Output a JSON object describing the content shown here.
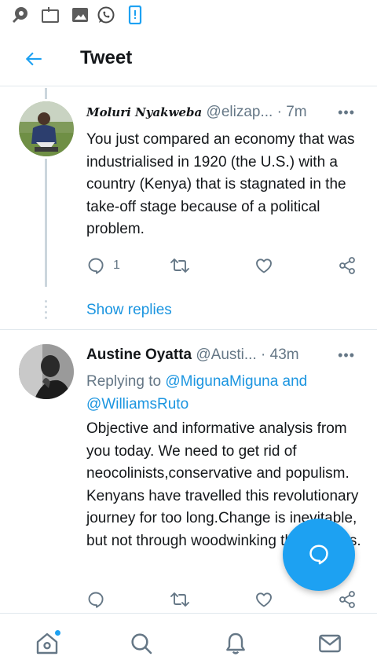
{
  "status_bar": {
    "icons": [
      "sync-icon",
      "notification-card-icon",
      "image-icon",
      "whatsapp-icon",
      "phone-icon"
    ]
  },
  "header": {
    "title": "Tweet",
    "back_icon": "arrow-left-icon"
  },
  "tweets": [
    {
      "display_name": "𝑴𝒐𝒍𝒖𝒓𝒊 𝑵𝒚𝒂𝒌𝒘𝒆𝒃𝒂",
      "handle": "@elizap...",
      "time": "· 7m",
      "more": "•••",
      "text": "You just compared an economy that was industrialised in 1920 (the U.S.) with a country (Kenya) that is stagnated in the take-off stage because of a political problem.",
      "reply_count": "1",
      "show_replies": "Show replies"
    },
    {
      "display_name": "Austine Oyatta",
      "handle": "@Austi...",
      "time": "· 43m",
      "more": "•••",
      "replying_prefix": "Replying to",
      "replying_to": "@MigunaMiguna and @WilliamsRuto",
      "text": "Objective and informative analysis from you today. We need to get rid of neocolinists,conservative  and populism. Kenyans have travelled this revolutionary journey for too long.Change is inevitable, but not through woodwinking the masses."
    }
  ],
  "bottom_nav": {
    "items": [
      "home-icon",
      "search-icon",
      "notifications-icon",
      "messages-icon"
    ],
    "home_has_badge": true
  },
  "colors": {
    "accent": "#1da1f2",
    "link": "#1b95e0",
    "text": "#14171a",
    "muted": "#657786",
    "border": "#e1e8ed"
  }
}
